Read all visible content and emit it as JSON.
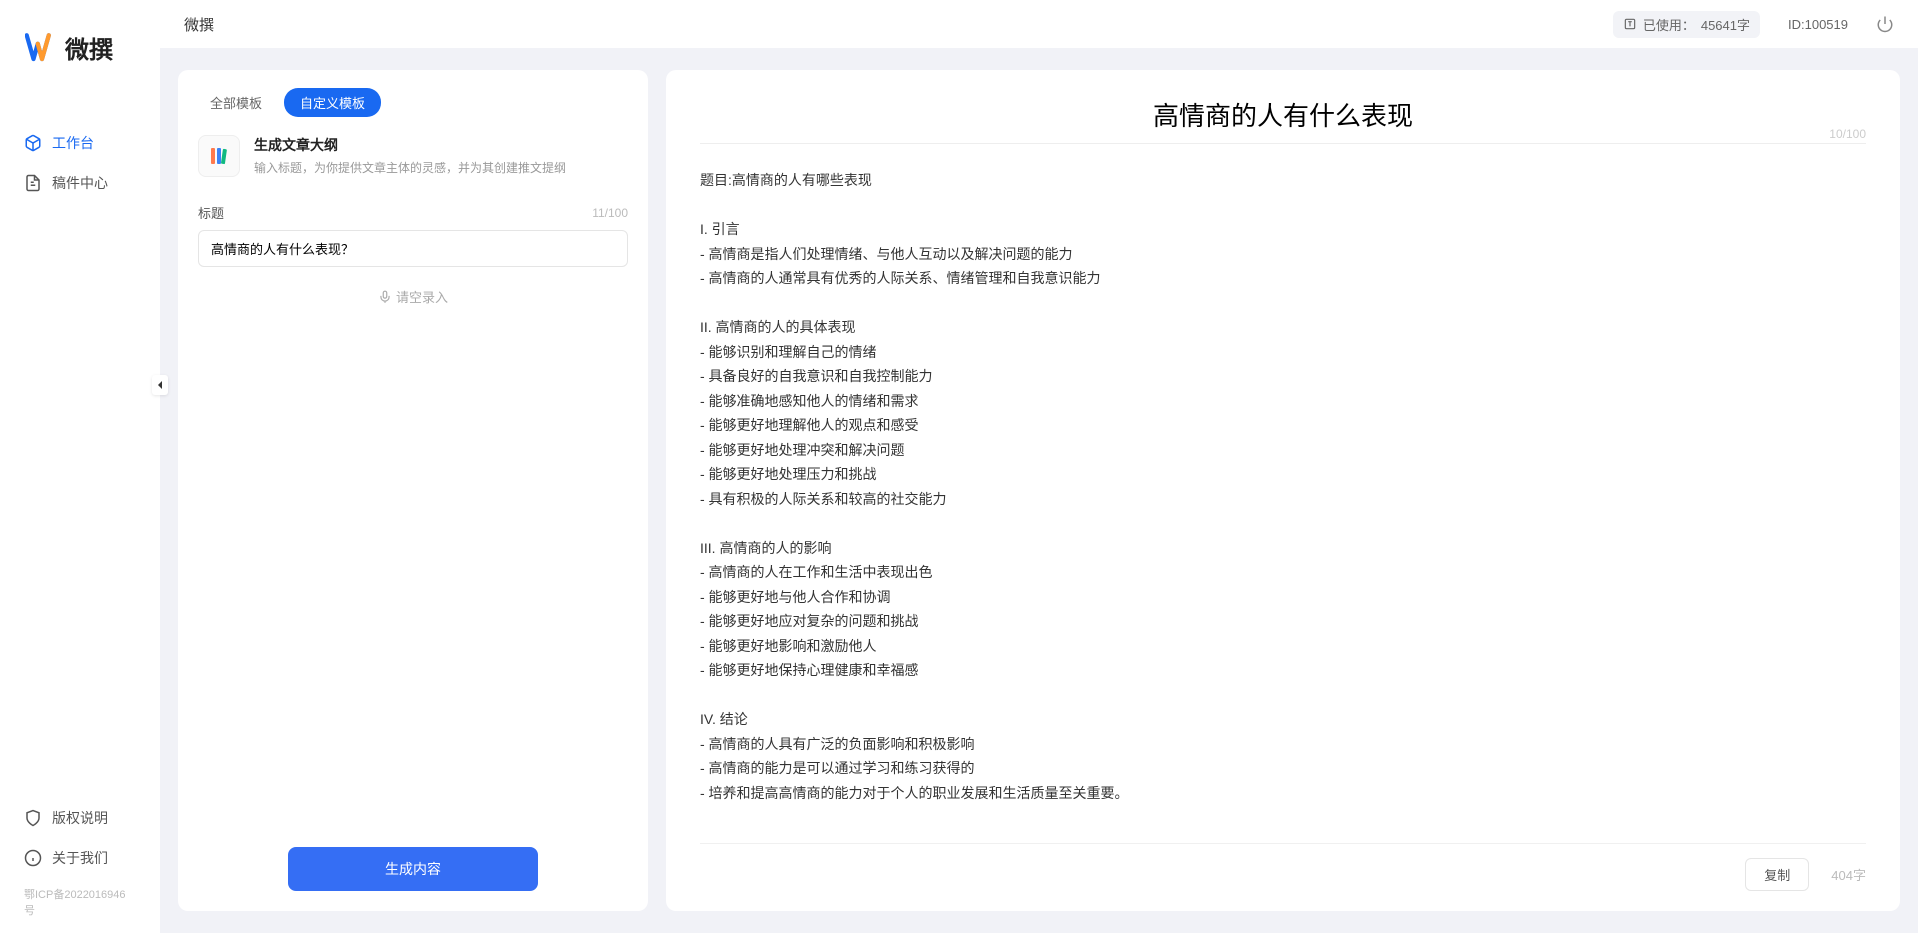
{
  "app": {
    "logo_text": "微撰",
    "header_title": "微撰",
    "icp": "鄂ICP备2022016946号"
  },
  "header": {
    "usage_prefix": "已使用：",
    "usage_value": "45641字",
    "user_id_label": "ID:100519"
  },
  "sidebar": {
    "nav": [
      {
        "label": "工作台",
        "active": true
      },
      {
        "label": "稿件中心",
        "active": false
      }
    ],
    "footer": [
      {
        "label": "版权说明"
      },
      {
        "label": "关于我们"
      }
    ]
  },
  "tabs": [
    {
      "label": "全部模板",
      "active": false
    },
    {
      "label": "自定义模板",
      "active": true
    }
  ],
  "template": {
    "title": "生成文章大纲",
    "desc": "输入标题，为你提供文章主体的灵感，并为其创建推文提纲"
  },
  "form": {
    "title_label": "标题",
    "title_counter": "11/100",
    "title_value": "高情商的人有什么表现？",
    "voice_label": "请空录入",
    "generate_btn": "生成内容"
  },
  "output": {
    "title": "高情商的人有什么表现",
    "title_counter": "10/100",
    "body": "题目:高情商的人有哪些表现\n\nI. 引言\n- 高情商是指人们处理情绪、与他人互动以及解决问题的能力\n- 高情商的人通常具有优秀的人际关系、情绪管理和自我意识能力\n\nII. 高情商的人的具体表现\n- 能够识别和理解自己的情绪\n- 具备良好的自我意识和自我控制能力\n- 能够准确地感知他人的情绪和需求\n- 能够更好地理解他人的观点和感受\n- 能够更好地处理冲突和解决问题\n- 能够更好地处理压力和挑战\n- 具有积极的人际关系和较高的社交能力\n\nIII. 高情商的人的影响\n- 高情商的人在工作和生活中表现出色\n- 能够更好地与他人合作和协调\n- 能够更好地应对复杂的问题和挑战\n- 能够更好地影响和激励他人\n- 能够更好地保持心理健康和幸福感\n\nIV. 结论\n- 高情商的人具有广泛的负面影响和积极影响\n- 高情商的能力是可以通过学习和练习获得的\n- 培养和提高高情商的能力对于个人的职业发展和生活质量至关重要。",
    "copy_btn": "复制",
    "word_count": "404字"
  }
}
